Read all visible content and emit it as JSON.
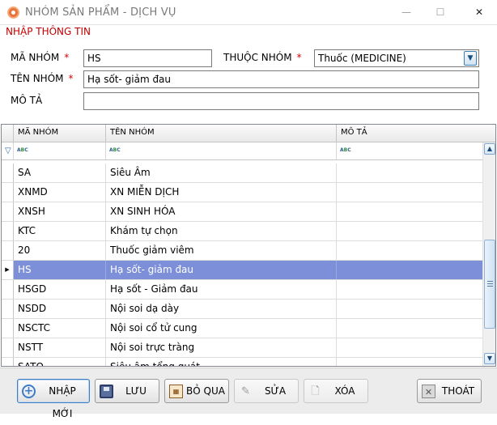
{
  "window": {
    "title": "NHÓM SẢN PHẨM - DỊCH VỤ",
    "minimize": "—",
    "maximize": "☐",
    "close": "✕"
  },
  "form": {
    "section_title": "NHẬP THÔNG TIN",
    "required_mark": "*",
    "ma_nhom_label": "MÃ NHÓM",
    "ma_nhom_value": "HS",
    "thuoc_nhom_label": "THUỘC NHÓM",
    "thuoc_nhom_value": "Thuốc (MEDICINE)",
    "ten_nhom_label": "TÊN NHÓM",
    "ten_nhom_value": "Hạ sốt- giảm đau",
    "mo_ta_label": "MÔ TẢ",
    "mo_ta_value": ""
  },
  "grid": {
    "columns": [
      "MÃ NHÓM",
      "TÊN NHÓM",
      "MÔ TẢ"
    ],
    "filter_icon": "funnel-icon",
    "rows": [
      {
        "ma": "SA",
        "ten": "Siêu Âm",
        "mota": "",
        "selected": false
      },
      {
        "ma": "XNMD",
        "ten": "XN MIỄN DỊCH",
        "mota": "",
        "selected": false
      },
      {
        "ma": "XNSH",
        "ten": "XN SINH HÓA",
        "mota": "",
        "selected": false
      },
      {
        "ma": "KTC",
        "ten": "Khám tự chọn",
        "mota": "",
        "selected": false
      },
      {
        "ma": "20",
        "ten": "Thuốc giảm viêm",
        "mota": "",
        "selected": false
      },
      {
        "ma": "HS",
        "ten": "Hạ sốt- giảm đau",
        "mota": "",
        "selected": true
      },
      {
        "ma": "HSGD",
        "ten": "Hạ sốt - Giảm đau",
        "mota": "",
        "selected": false
      },
      {
        "ma": "NSDD",
        "ten": "Nội soi dạ dày",
        "mota": "",
        "selected": false
      },
      {
        "ma": "NSCTC",
        "ten": "Nội soi cổ tử cung",
        "mota": "",
        "selected": false
      },
      {
        "ma": "NSTT",
        "ten": "Nội soi trực tràng",
        "mota": "",
        "selected": false
      },
      {
        "ma": "SATQ",
        "ten": "Siêu âm tổng quát",
        "mota": "",
        "selected": false
      }
    ]
  },
  "buttons": {
    "new": "NHẬP MỚI",
    "save": "LƯU",
    "skip": "BỎ QUA",
    "edit": "SỬA",
    "delete": "XÓA",
    "exit": "THOÁT"
  },
  "colors": {
    "section_title": "#c00000",
    "required": "#e00000",
    "selected_row": "#7d8fd9"
  }
}
